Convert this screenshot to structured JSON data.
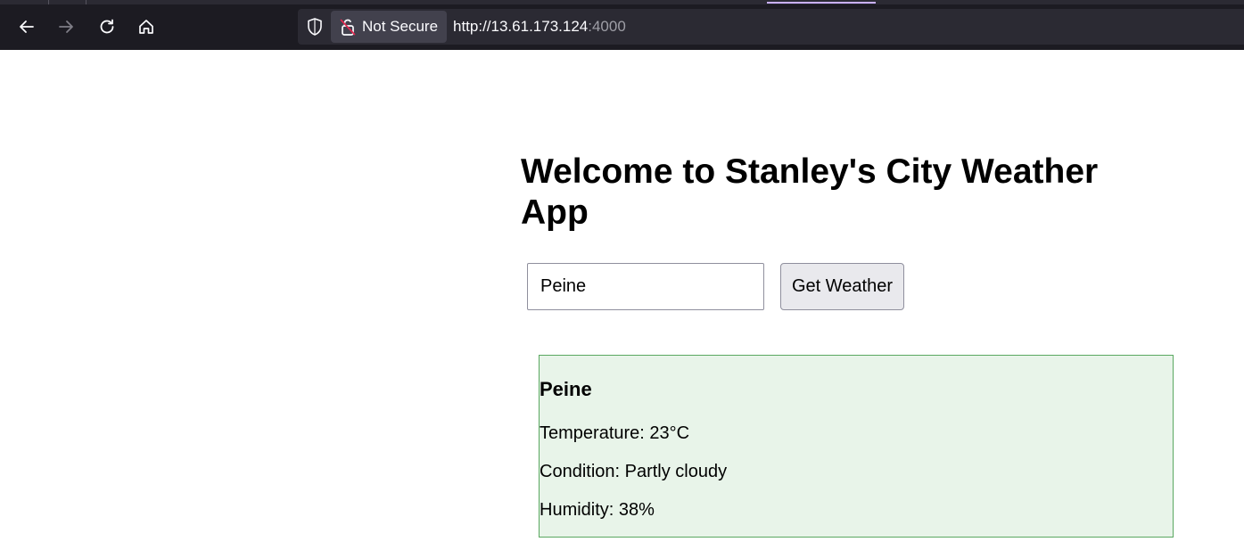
{
  "browser": {
    "security_label": "Not Secure",
    "url_main": "http://13.61.173.124",
    "url_port": ":4000"
  },
  "page": {
    "title": "Welcome to Stanley's City Weather App",
    "city_input_value": "Peine",
    "get_weather_label": "Get Weather"
  },
  "weather": {
    "city": "Peine",
    "temperature": "Temperature: 23°C",
    "condition": "Condition: Partly cloudy",
    "humidity": "Humidity: 38%"
  },
  "colors": {
    "chrome_bg": "#1c1b22",
    "card_bg": "#e8f4e9",
    "card_border": "#5aa860"
  }
}
